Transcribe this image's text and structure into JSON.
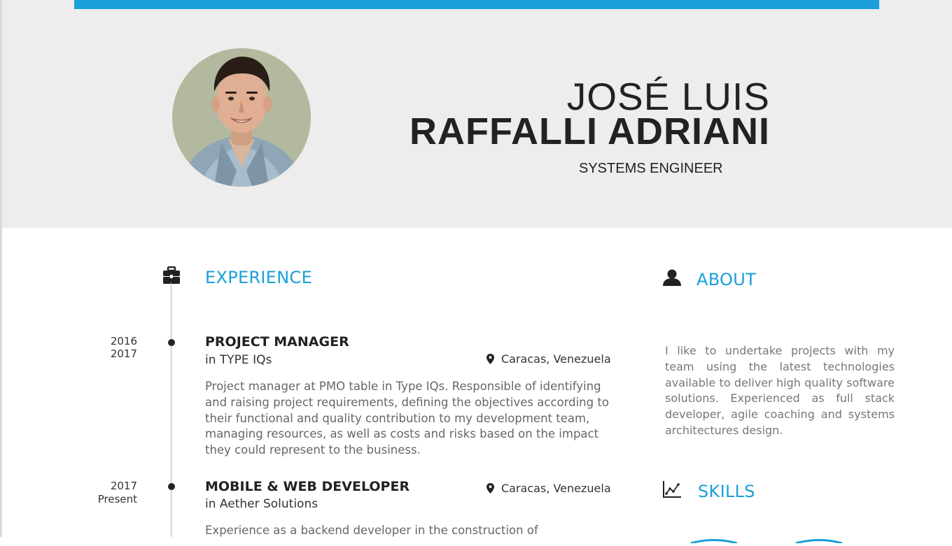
{
  "profile": {
    "first_name": "JOSÉ LUIS",
    "last_name": "RAFFALLI ADRIANI",
    "title": "SYSTEMS ENGINEER",
    "photo_alt": "profile photo"
  },
  "colors": {
    "accent": "#1a9fd9",
    "header_bg": "#ededed",
    "text_dark": "#222222",
    "text_muted": "#666666"
  },
  "experience": {
    "title": "EXPERIENCE",
    "icon": "briefcase-icon",
    "jobs": [
      {
        "year_start": "2016",
        "year_end": "2017",
        "role": "PROJECT MANAGER",
        "company": "in TYPE IQs",
        "location": "Caracas, Venezuela",
        "description": "Project manager at PMO table in Type IQs. Responsible of identifying and raising project requirements, defining the objectives according to their functional and quality contribution to my development team, managing resources, as well as costs and risks based on the impact they could represent to the business."
      },
      {
        "year_start": "2017",
        "year_end": "Present",
        "role": "MOBILE & WEB DEVELOPER",
        "company": "in Aether Solutions",
        "location": "Caracas, Venezuela",
        "description": "Experience as a backend developer in the construction of"
      }
    ]
  },
  "about": {
    "title": "ABOUT",
    "icon": "user-icon",
    "text": "I like to undertake projects with my team using the latest technologies available to deliver high quality software solutions. Experienced as full stack developer, agile coaching and systems architectures design."
  },
  "skills": {
    "title": "SKILLS",
    "icon": "chart-line-icon"
  }
}
